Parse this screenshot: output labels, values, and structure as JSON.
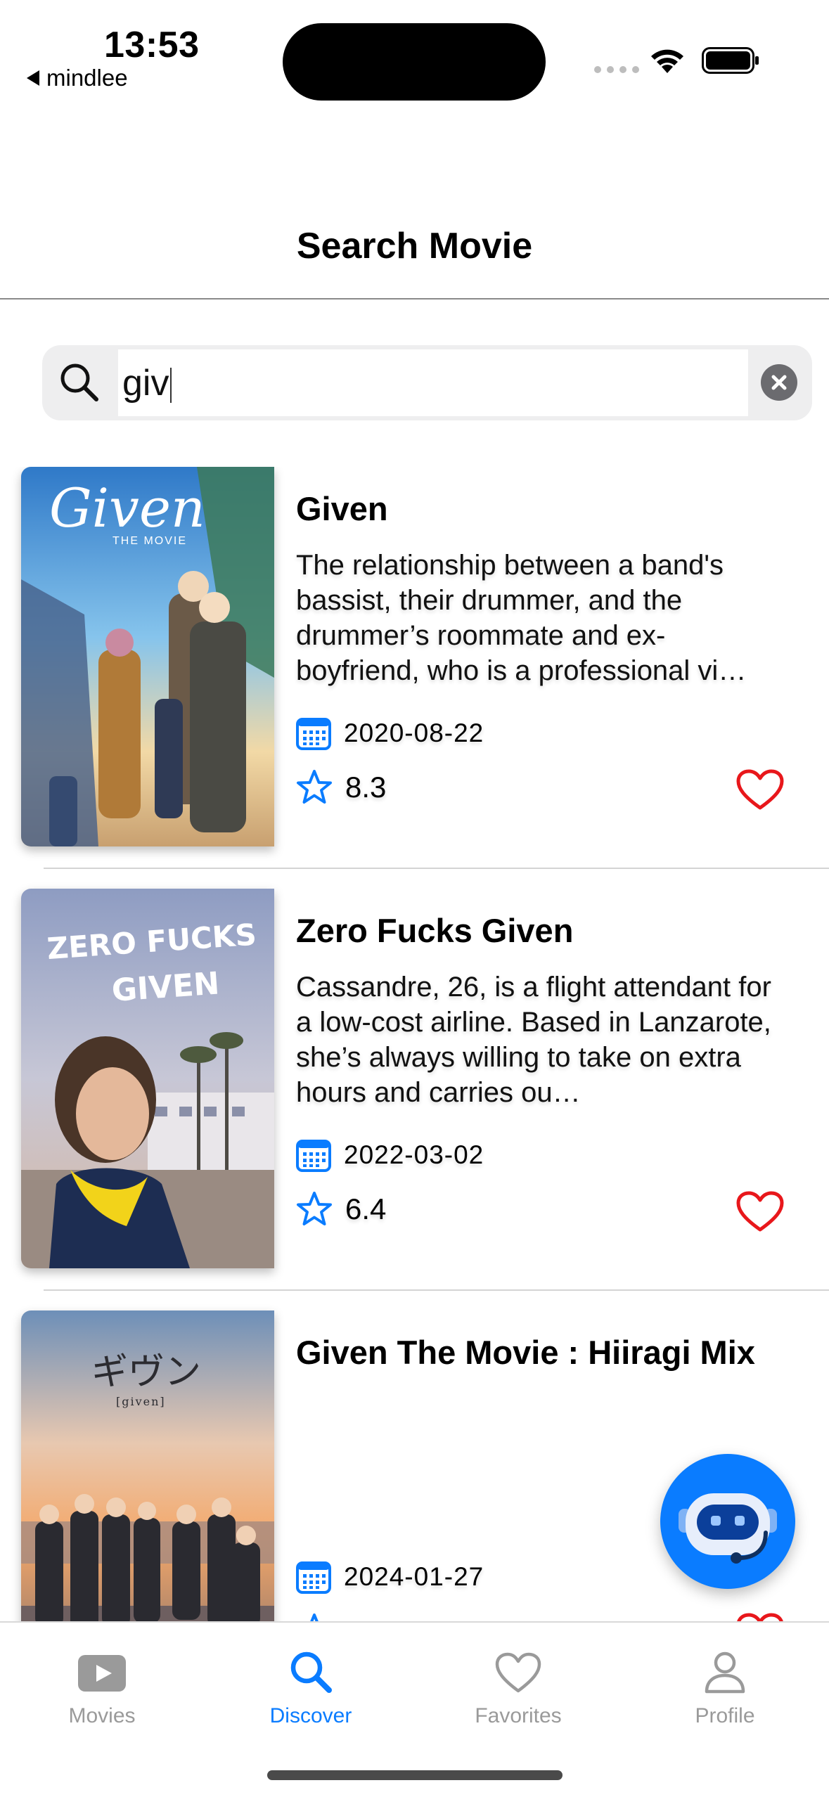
{
  "status_bar": {
    "time": "13:53",
    "back_app": "mindlee"
  },
  "header": {
    "title": "Search Movie"
  },
  "search": {
    "value": "giv",
    "placeholder": "",
    "clear_icon": "clear-icon"
  },
  "movies": [
    {
      "title": "Given",
      "overview": "The relationship between a band's bassist, their drummer, and the drummer’s roommate and ex-boyfriend, who is a professional vi…",
      "release_date": "2020-08-22",
      "rating": "8.3",
      "poster_text": "Given",
      "poster_subtext": "THE MOVIE"
    },
    {
      "title": "Zero Fucks Given",
      "overview": "Cassandre, 26, is a flight attendant for a low-cost airline. Based in Lanzarote, she’s always willing to take on extra hours and carries ou…",
      "release_date": "2022-03-02",
      "rating": "6.4",
      "poster_text": "ZERO FUCKS",
      "poster_subtext": "GIVEN"
    },
    {
      "title": "Given The Movie : Hiiragi Mix",
      "overview": "",
      "release_date": "2024-01-27",
      "rating": "",
      "poster_text": "ギヴン",
      "poster_subtext": "[given]"
    }
  ],
  "tabs": [
    {
      "label": "Movies",
      "icon": "play-icon",
      "active": false
    },
    {
      "label": "Discover",
      "icon": "search-icon",
      "active": true
    },
    {
      "label": "Favorites",
      "icon": "heart-icon",
      "active": false
    },
    {
      "label": "Profile",
      "icon": "person-icon",
      "active": false
    }
  ],
  "colors": {
    "accent": "#0A7CFF",
    "favorite": "#E8171B",
    "inactive_tab": "#9A9A9A"
  }
}
